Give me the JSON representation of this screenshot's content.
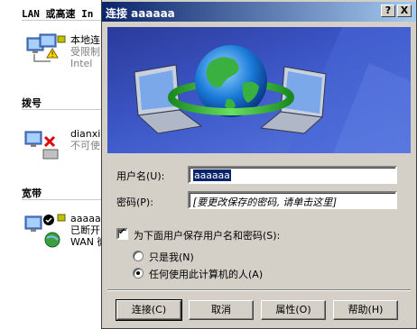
{
  "background": {
    "sections": [
      {
        "heading": "LAN 或高速 In",
        "items": [
          {
            "name": "本地连",
            "status": "受限制",
            "device": "Intel"
          }
        ]
      },
      {
        "heading": "拨号",
        "items": [
          {
            "name": "dianxi",
            "status": "不可使",
            "device": ""
          }
        ]
      },
      {
        "heading": "宽带",
        "items": [
          {
            "name": "aaaaaa",
            "status": "已断开",
            "device": "WAN 微"
          }
        ]
      }
    ]
  },
  "dialog": {
    "title": "连接 aaaaaa",
    "help_btn": "?",
    "close_btn": "X",
    "username_label": "用户名(U):",
    "username_value": "aaaaaa",
    "password_label": "密码(P):",
    "password_value": "[要更改保存的密码, 请单击这里]",
    "save_checkbox_label": "为下面用户保存用户名和密码(S):",
    "save_checked": true,
    "radio_only_me": "只是我(N)",
    "radio_anyone": "任何使用此计算机的人(A)",
    "selected_radio": "anyone",
    "buttons": {
      "connect": "连接(C)",
      "cancel": "取消",
      "properties": "属性(O)",
      "help": "帮助(H)"
    }
  },
  "colors": {
    "titlebar_start": "#0a246a",
    "titlebar_end": "#a6caf0",
    "dialog_face": "#d4d0c8",
    "banner": "#3d57c8"
  }
}
